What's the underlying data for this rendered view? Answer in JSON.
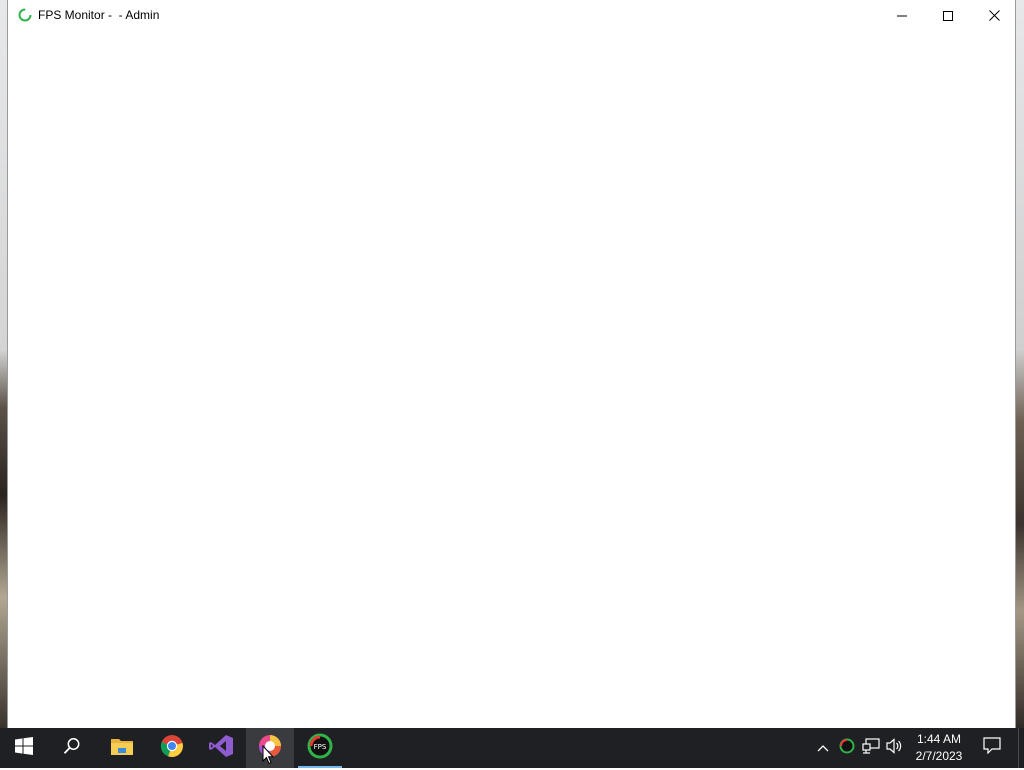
{
  "window": {
    "title": "FPS Monitor -  - Admin",
    "controls": {
      "minimize": "minimize",
      "maximize": "maximize",
      "close": "close"
    }
  },
  "taskbar": {
    "apps": [
      {
        "name": "start",
        "icon": "windows-logo-icon"
      },
      {
        "name": "search",
        "icon": "search-icon"
      },
      {
        "name": "file-explorer",
        "icon": "folder-icon"
      },
      {
        "name": "chrome",
        "icon": "chrome-icon"
      },
      {
        "name": "visual-studio",
        "icon": "visual-studio-icon"
      },
      {
        "name": "color-app",
        "icon": "color-wheel-icon"
      },
      {
        "name": "fps-monitor",
        "icon": "fps-monitor-icon",
        "active": true
      }
    ],
    "tray": {
      "icons": [
        "chevron-up-icon",
        "fps-tray-icon",
        "network-icon",
        "volume-icon"
      ],
      "time": "1:44 AM",
      "date": "2/7/2023"
    }
  },
  "colors": {
    "taskbar": "#1f2023",
    "active_underline": "#76b9ed",
    "fps_green": "#2fb34a"
  }
}
